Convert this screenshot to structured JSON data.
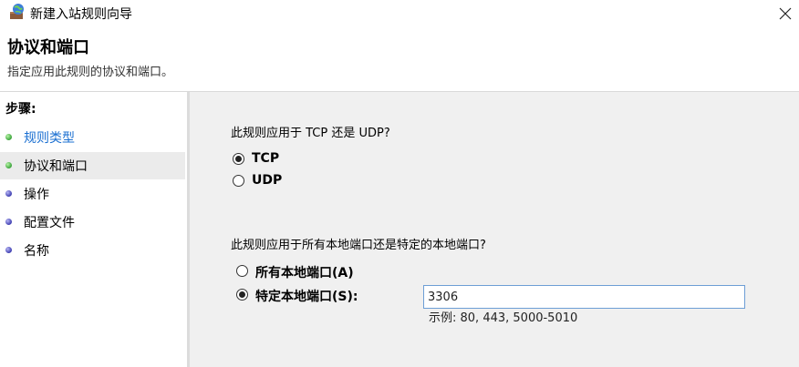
{
  "window": {
    "title": "新建入站规则向导",
    "close": "×"
  },
  "header": {
    "title": "协议和端口",
    "subtitle": "指定应用此规则的协议和端口。"
  },
  "sidebar": {
    "heading": "步骤:",
    "steps": [
      {
        "label": "规则类型",
        "state": "link"
      },
      {
        "label": "协议和端口",
        "state": "current"
      },
      {
        "label": "操作",
        "state": "pending"
      },
      {
        "label": "配置文件",
        "state": "pending"
      },
      {
        "label": "名称",
        "state": "pending"
      }
    ]
  },
  "main": {
    "protocol_question": "此规则应用于 TCP 还是 UDP?",
    "protocols": [
      {
        "label": "TCP",
        "selected": true
      },
      {
        "label": "UDP",
        "selected": false
      }
    ],
    "port_question": "此规则应用于所有本地端口还是特定的本地端口?",
    "port_options": [
      {
        "label": "所有本地端口(A)",
        "selected": false
      },
      {
        "label": "特定本地端口(S):",
        "selected": true
      }
    ],
    "port_value": "3306",
    "example": "示例: 80, 443, 5000-5010"
  }
}
